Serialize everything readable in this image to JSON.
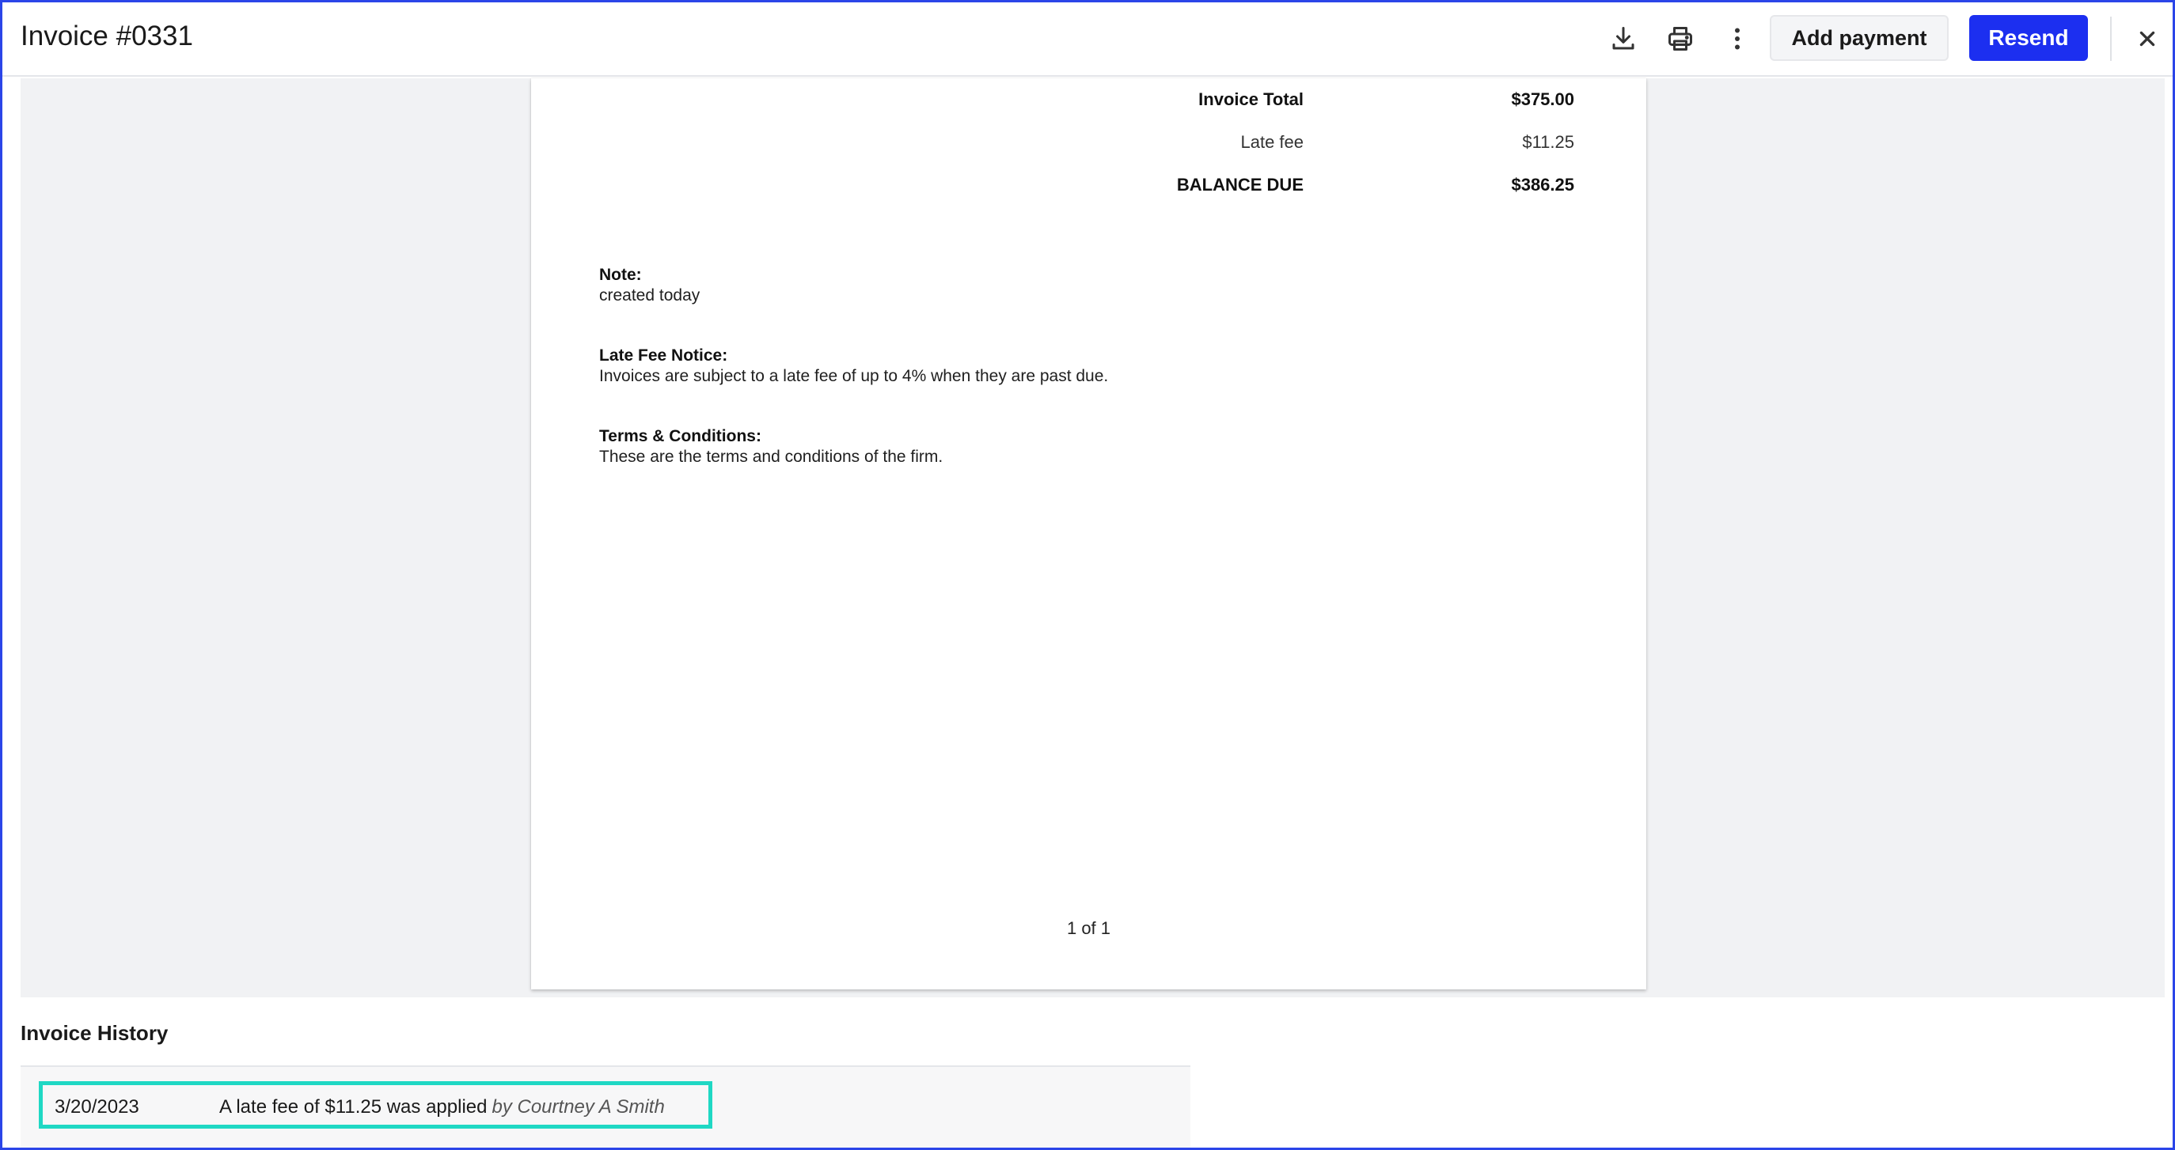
{
  "header": {
    "title": "Invoice #0331",
    "add_payment_label": "Add payment",
    "resend_label": "Resend",
    "icons": {
      "download": "download-icon",
      "print": "print-icon",
      "more": "more-vertical-icon",
      "close": "close-icon"
    }
  },
  "invoice": {
    "totals": [
      {
        "label": "Invoice Total",
        "value": "$375.00",
        "bold": true
      },
      {
        "label": "Late fee",
        "value": "$11.25",
        "bold": false
      },
      {
        "label": "BALANCE DUE",
        "value": "$386.25",
        "bold": true
      }
    ],
    "note": {
      "title": "Note:",
      "text": "created today"
    },
    "late_fee_notice": {
      "title": "Late Fee Notice:",
      "text": "Invoices are subject to a late fee of up to 4% when they are past due."
    },
    "terms": {
      "title": "Terms & Conditions:",
      "text": "These are the terms and conditions of the firm."
    },
    "page_indicator": "1 of 1"
  },
  "history": {
    "title": "Invoice History",
    "rows": [
      {
        "date": "3/20/2023",
        "description": "A late fee of $11.25 was applied",
        "by": "by Courtney A Smith"
      }
    ]
  },
  "colors": {
    "primary": "#1c2ff0",
    "highlight": "#1fd8c4",
    "frame": "#2b45e8",
    "background": "#f1f2f4"
  }
}
